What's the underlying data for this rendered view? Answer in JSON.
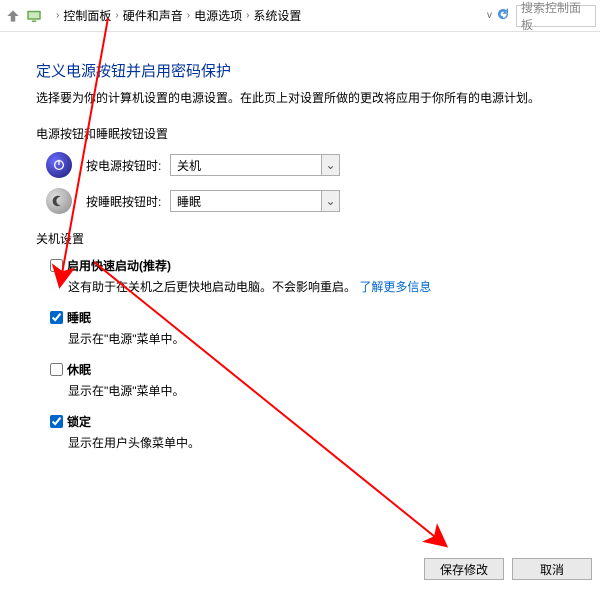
{
  "toolbar": {
    "breadcrumb": [
      "控制面板",
      "硬件和声音",
      "电源选项",
      "系统设置"
    ],
    "search_placeholder": "搜索控制面板"
  },
  "page": {
    "title": "定义电源按钮并启用密码保护",
    "desc": "选择要为你的计算机设置的电源设置。在此页上对设置所做的更改将应用于你所有的电源计划。"
  },
  "buttons_section": {
    "header": "电源按钮和睡眠按钮设置",
    "rows": [
      {
        "label": "按电源按钮时:",
        "value": "关机"
      },
      {
        "label": "按睡眠按钮时:",
        "value": "睡眠"
      }
    ]
  },
  "shutdown_section": {
    "header": "关机设置",
    "items": [
      {
        "checked": false,
        "title": "启用快速启动(推荐)",
        "desc": "这有助于在关机之后更快地启动电脑。不会影响重启。",
        "link": "了解更多信息"
      },
      {
        "checked": true,
        "title": "睡眠",
        "desc": "显示在\"电源\"菜单中。"
      },
      {
        "checked": false,
        "title": "休眠",
        "desc": "显示在\"电源\"菜单中。"
      },
      {
        "checked": true,
        "title": "锁定",
        "desc": "显示在用户头像菜单中。"
      }
    ]
  },
  "footer": {
    "save": "保存修改",
    "cancel": "取消"
  }
}
